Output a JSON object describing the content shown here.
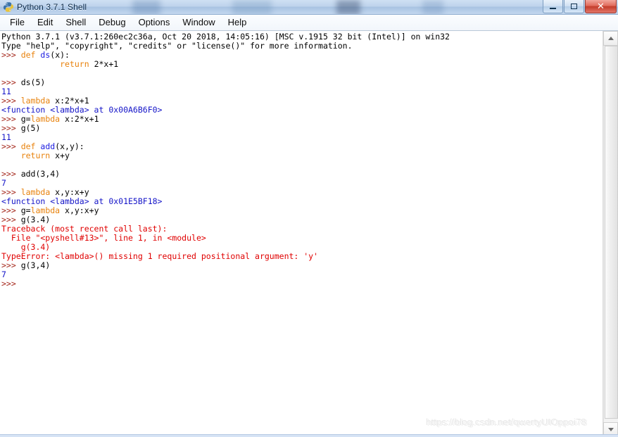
{
  "window": {
    "title": "Python 3.7.1 Shell",
    "icon": "python-logo-icon",
    "buttons": {
      "minimize": "Minimize",
      "maximize": "Maximize",
      "close": "✕"
    }
  },
  "menubar": {
    "items": [
      {
        "label": "File"
      },
      {
        "label": "Edit"
      },
      {
        "label": "Shell"
      },
      {
        "label": "Debug"
      },
      {
        "label": "Options"
      },
      {
        "label": "Window"
      },
      {
        "label": "Help"
      }
    ]
  },
  "console": {
    "lines": [
      {
        "segments": [
          {
            "text": "Python 3.7.1 (v3.7.1:260ec2c36a, Oct 20 2018, 14:05:16) [MSC v.1915 32 bit (Intel)] on win32",
            "style": "tok-norm"
          }
        ]
      },
      {
        "segments": [
          {
            "text": "Type \"help\", \"copyright\", \"credits\" or \"license()\" for more information.",
            "style": "tok-norm"
          }
        ]
      },
      {
        "segments": [
          {
            "text": ">>> ",
            "style": "tok-prompt"
          },
          {
            "text": "def ",
            "style": "tok-kw"
          },
          {
            "text": "ds",
            "style": "tok-def"
          },
          {
            "text": "(x):",
            "style": "tok-norm"
          }
        ]
      },
      {
        "segments": [
          {
            "text": "\t",
            "style": "tok-norm"
          },
          {
            "text": "    return ",
            "style": "tok-kw"
          },
          {
            "text": "2*x+1",
            "style": "tok-norm"
          }
        ]
      },
      {
        "segments": [
          {
            "text": "",
            "style": "tok-norm"
          }
        ]
      },
      {
        "segments": [
          {
            "text": ">>> ",
            "style": "tok-prompt"
          },
          {
            "text": "ds(5)",
            "style": "tok-norm"
          }
        ]
      },
      {
        "segments": [
          {
            "text": "11",
            "style": "tok-out"
          }
        ]
      },
      {
        "segments": [
          {
            "text": ">>> ",
            "style": "tok-prompt"
          },
          {
            "text": "lambda",
            "style": "tok-kw"
          },
          {
            "text": " x:2*x+1",
            "style": "tok-norm"
          }
        ]
      },
      {
        "segments": [
          {
            "text": "<function <lambda> at 0x00A6B6F0>",
            "style": "tok-out"
          }
        ]
      },
      {
        "segments": [
          {
            "text": ">>> ",
            "style": "tok-prompt"
          },
          {
            "text": "g=",
            "style": "tok-norm"
          },
          {
            "text": "lambda",
            "style": "tok-kw"
          },
          {
            "text": " x:2*x+1",
            "style": "tok-norm"
          }
        ]
      },
      {
        "segments": [
          {
            "text": ">>> ",
            "style": "tok-prompt"
          },
          {
            "text": "g(5)",
            "style": "tok-norm"
          }
        ]
      },
      {
        "segments": [
          {
            "text": "11",
            "style": "tok-out"
          }
        ]
      },
      {
        "segments": [
          {
            "text": ">>> ",
            "style": "tok-prompt"
          },
          {
            "text": "def ",
            "style": "tok-kw"
          },
          {
            "text": "add",
            "style": "tok-def"
          },
          {
            "text": "(x,y):",
            "style": "tok-norm"
          }
        ]
      },
      {
        "segments": [
          {
            "text": "    return ",
            "style": "tok-kw"
          },
          {
            "text": "x+y",
            "style": "tok-norm"
          }
        ]
      },
      {
        "segments": [
          {
            "text": "",
            "style": "tok-norm"
          }
        ]
      },
      {
        "segments": [
          {
            "text": ">>> ",
            "style": "tok-prompt"
          },
          {
            "text": "add(3,4)",
            "style": "tok-norm"
          }
        ]
      },
      {
        "segments": [
          {
            "text": "7",
            "style": "tok-out"
          }
        ]
      },
      {
        "segments": [
          {
            "text": ">>> ",
            "style": "tok-prompt"
          },
          {
            "text": "lambda",
            "style": "tok-kw"
          },
          {
            "text": " x,y:x+y",
            "style": "tok-norm"
          }
        ]
      },
      {
        "segments": [
          {
            "text": "<function <lambda> at 0x01E5BF18>",
            "style": "tok-out"
          }
        ]
      },
      {
        "segments": [
          {
            "text": ">>> ",
            "style": "tok-prompt"
          },
          {
            "text": "g=",
            "style": "tok-norm"
          },
          {
            "text": "lambda",
            "style": "tok-kw"
          },
          {
            "text": " x,y:x+y",
            "style": "tok-norm"
          }
        ]
      },
      {
        "segments": [
          {
            "text": ">>> ",
            "style": "tok-prompt"
          },
          {
            "text": "g(3.4)",
            "style": "tok-norm"
          }
        ]
      },
      {
        "segments": [
          {
            "text": "Traceback (most recent call last):",
            "style": "tok-err"
          }
        ]
      },
      {
        "segments": [
          {
            "text": "  File \"<pyshell#13>\", line 1, in <module>",
            "style": "tok-err"
          }
        ]
      },
      {
        "segments": [
          {
            "text": "    g(3.4)",
            "style": "tok-err"
          }
        ]
      },
      {
        "segments": [
          {
            "text": "TypeError: <lambda>() missing 1 required positional argument: 'y'",
            "style": "tok-err"
          }
        ]
      },
      {
        "segments": [
          {
            "text": ">>> ",
            "style": "tok-prompt"
          },
          {
            "text": "g(3,4)",
            "style": "tok-norm"
          }
        ]
      },
      {
        "segments": [
          {
            "text": "7",
            "style": "tok-out"
          }
        ]
      },
      {
        "segments": [
          {
            "text": ">>> ",
            "style": "tok-prompt"
          }
        ]
      }
    ]
  },
  "scrollbar": {
    "up_arrow": "scroll-up",
    "down_arrow": "scroll-down"
  },
  "watermark": {
    "text": "https://blog.csdn.net/qwertyUIOppoi78"
  },
  "colors": {
    "prompt": "#a5281c",
    "keyword": "#e8820c",
    "definition": "#1a1ae0",
    "output": "#1414c8",
    "error": "#e00000",
    "normal": "#000000",
    "titlebar": "#bed3ec",
    "close_button": "#c33c2b"
  }
}
